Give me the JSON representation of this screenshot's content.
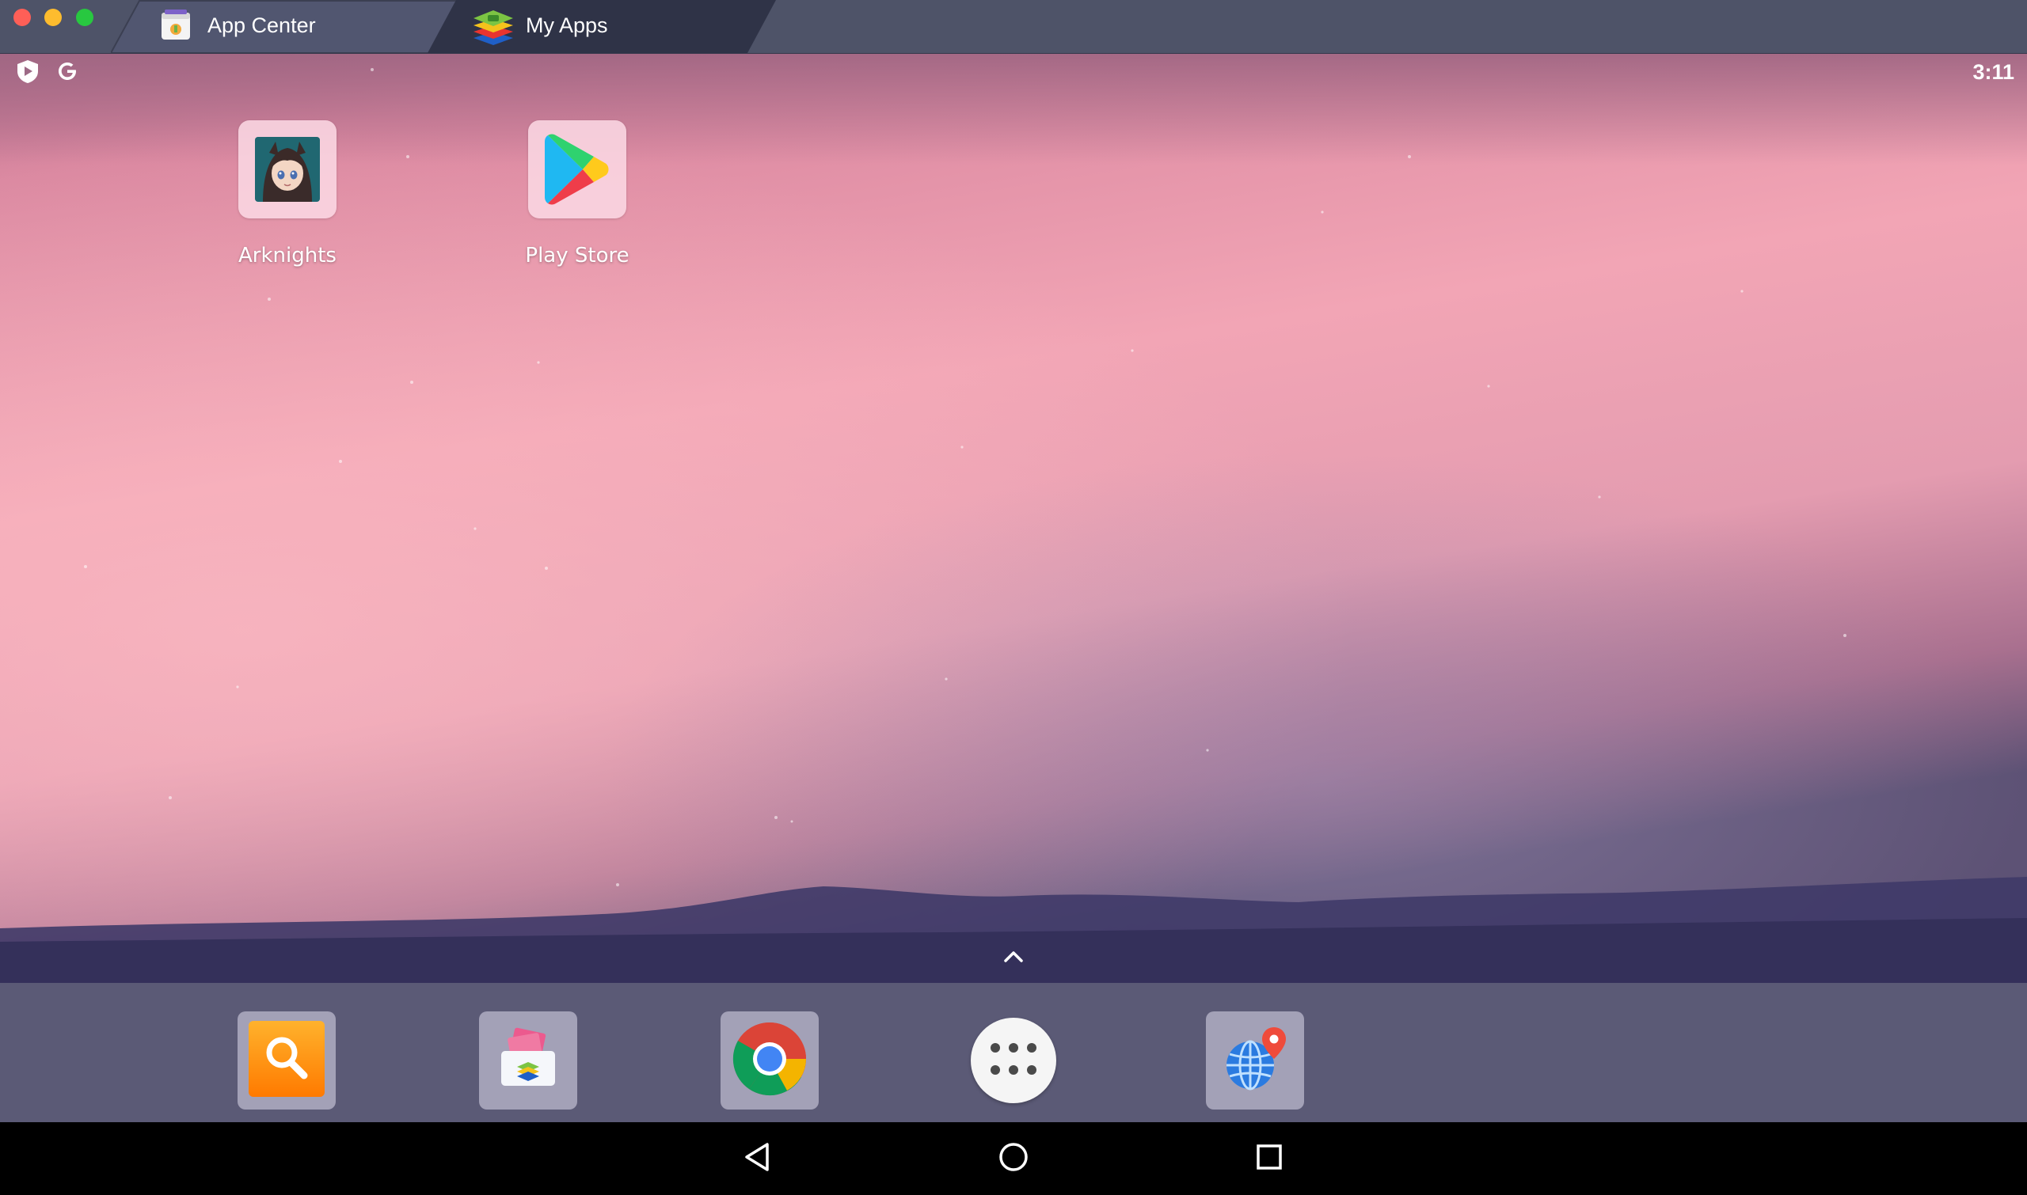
{
  "window": {
    "tabs": [
      {
        "label": "App Center",
        "active": false
      },
      {
        "label": "My Apps",
        "active": true
      }
    ]
  },
  "status_bar": {
    "left_icons": [
      "shield-play-icon",
      "google-g-icon"
    ],
    "time": "3:11"
  },
  "home": {
    "apps": [
      {
        "label": "Arknights",
        "icon": "arknights-icon"
      },
      {
        "label": "Play Store",
        "icon": "play-store-icon"
      }
    ]
  },
  "dock": {
    "items": [
      {
        "icon": "search-icon"
      },
      {
        "icon": "media-manager-icon"
      },
      {
        "icon": "chrome-icon"
      },
      {
        "icon": "all-apps-icon"
      },
      {
        "icon": "globe-location-icon"
      }
    ]
  },
  "nav_bar": {
    "buttons": [
      "back-icon",
      "home-icon",
      "recents-icon"
    ]
  },
  "colors": {
    "titlebar": "#4e5368",
    "active_tab": "#2f3347",
    "dock": "#5b5a76",
    "navbar": "#000000"
  }
}
